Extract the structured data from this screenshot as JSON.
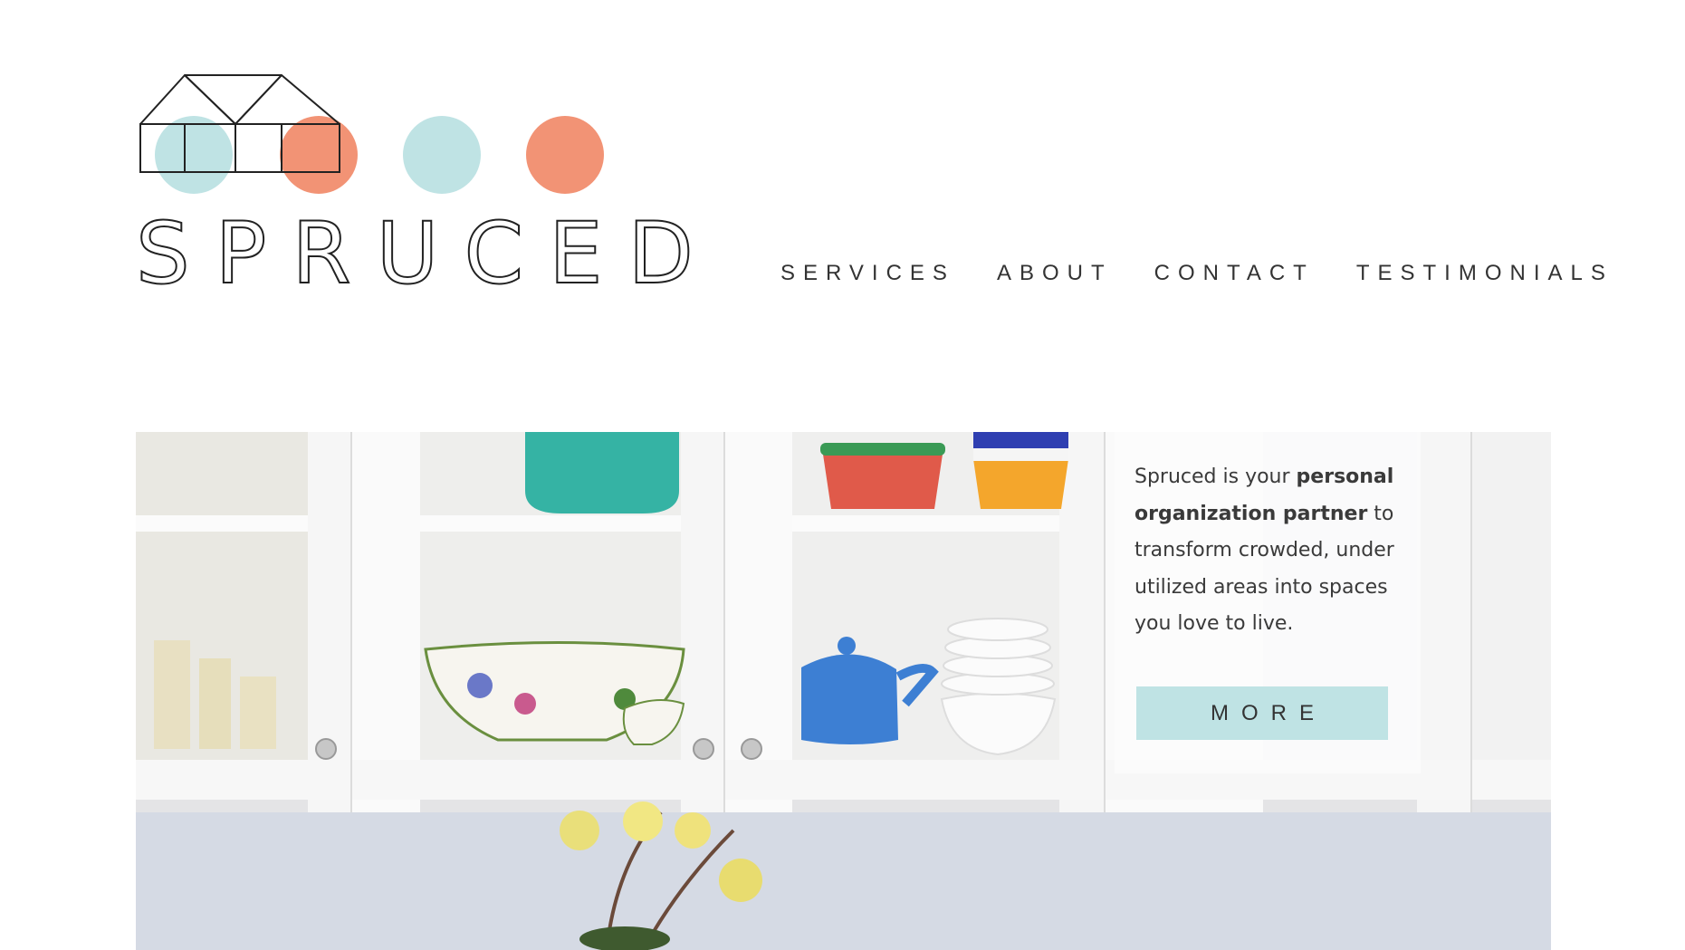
{
  "brand": {
    "name": "SPRUCED",
    "colors": {
      "teal": "#bfe3e4",
      "coral": "#f29375",
      "line": "#222222"
    }
  },
  "nav": {
    "items": [
      "SERVICES",
      "ABOUT",
      "CONTACT",
      "TESTIMONIALS"
    ]
  },
  "hero": {
    "text_before": "Spruced is your ",
    "text_bold": "personal organization partner",
    "text_after": " to transform crowded, under utilized areas into spaces you love to live.",
    "button_label": "MORE"
  }
}
